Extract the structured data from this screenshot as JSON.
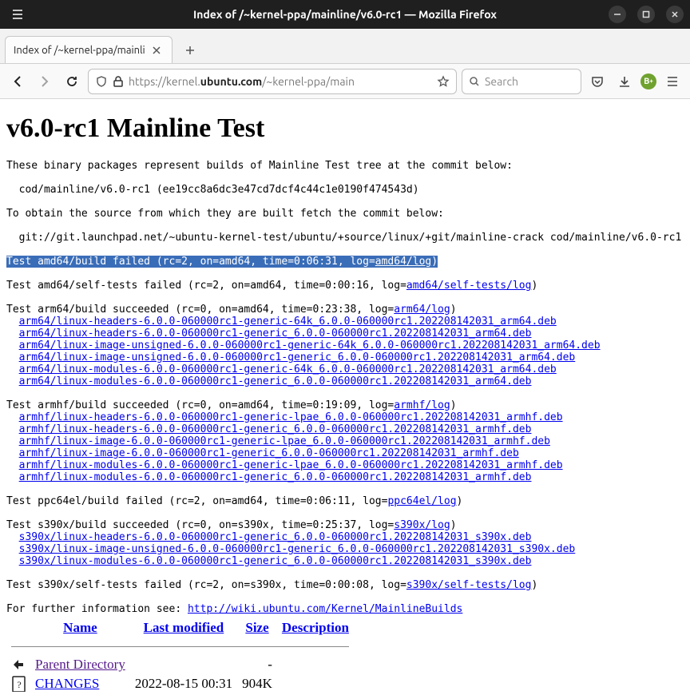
{
  "window": {
    "title": "Index of /~kernel-ppa/mainline/v6.0-rc1 — Mozilla Firefox"
  },
  "tab": {
    "label": "Index of /~kernel-ppa/mainli"
  },
  "urlbar": {
    "scheme": "https://",
    "pre": "kernel.",
    "host": "ubuntu.com",
    "path": "/~kernel-ppa/main"
  },
  "searchbar": {
    "placeholder": "Search"
  },
  "extension": {
    "letter": "B"
  },
  "page": {
    "h1": "v6.0-rc1 Mainline Test",
    "l1": "These binary packages represent builds of Mainline Test tree at the commit below:",
    "l2": "  cod/mainline/v6.0-rc1 (ee19cc8a6dc3e47cd7dcf4c44c1e0190f474543d)",
    "l3": "To obtain the source from which they are built fetch the commit below:",
    "l4": "  git://git.launchpad.net/~ubuntu-kernel-test/ubuntu/+source/linux/+git/mainline-crack cod/mainline/v6.0-rc1",
    "amd64_fail_pre": "Test amd64/build failed (rc=2, on=amd64, time=0:06:31, log=",
    "amd64_fail_log": "amd64/log",
    "amd64_fail_post": ")",
    "amd64_self_pre": "Test amd64/self-tests failed (rc=2, on=amd64, time=0:00:16, log=",
    "amd64_self_log": "amd64/self-tests/log",
    "amd64_self_post": ")",
    "arm64_pre": "Test arm64/build succeeded (rc=0, on=amd64, time=0:23:38, log=",
    "arm64_log": "arm64/log",
    "arm64_post": ")",
    "arm64_files": [
      "arm64/linux-headers-6.0.0-060000rc1-generic-64k_6.0.0-060000rc1.202208142031_arm64.deb",
      "arm64/linux-headers-6.0.0-060000rc1-generic_6.0.0-060000rc1.202208142031_arm64.deb",
      "arm64/linux-image-unsigned-6.0.0-060000rc1-generic-64k_6.0.0-060000rc1.202208142031_arm64.deb",
      "arm64/linux-image-unsigned-6.0.0-060000rc1-generic_6.0.0-060000rc1.202208142031_arm64.deb",
      "arm64/linux-modules-6.0.0-060000rc1-generic-64k_6.0.0-060000rc1.202208142031_arm64.deb",
      "arm64/linux-modules-6.0.0-060000rc1-generic_6.0.0-060000rc1.202208142031_arm64.deb"
    ],
    "armhf_pre": "Test armhf/build succeeded (rc=0, on=amd64, time=0:19:09, log=",
    "armhf_log": "armhf/log",
    "armhf_post": ")",
    "armhf_files": [
      "armhf/linux-headers-6.0.0-060000rc1-generic-lpae_6.0.0-060000rc1.202208142031_armhf.deb",
      "armhf/linux-headers-6.0.0-060000rc1-generic_6.0.0-060000rc1.202208142031_armhf.deb",
      "armhf/linux-image-6.0.0-060000rc1-generic-lpae_6.0.0-060000rc1.202208142031_armhf.deb",
      "armhf/linux-image-6.0.0-060000rc1-generic_6.0.0-060000rc1.202208142031_armhf.deb",
      "armhf/linux-modules-6.0.0-060000rc1-generic-lpae_6.0.0-060000rc1.202208142031_armhf.deb",
      "armhf/linux-modules-6.0.0-060000rc1-generic_6.0.0-060000rc1.202208142031_armhf.deb"
    ],
    "ppc_pre": "Test ppc64el/build failed (rc=2, on=amd64, time=0:06:11, log=",
    "ppc_log": "ppc64el/log",
    "ppc_post": ")",
    "s390_pre": "Test s390x/build succeeded (rc=0, on=s390x, time=0:25:37, log=",
    "s390_log": "s390x/log",
    "s390_post": ")",
    "s390_files": [
      "s390x/linux-headers-6.0.0-060000rc1-generic_6.0.0-060000rc1.202208142031_s390x.deb",
      "s390x/linux-image-unsigned-6.0.0-060000rc1-generic_6.0.0-060000rc1.202208142031_s390x.deb",
      "s390x/linux-modules-6.0.0-060000rc1-generic_6.0.0-060000rc1.202208142031_s390x.deb"
    ],
    "s390_self_pre": "Test s390x/self-tests failed (rc=2, on=s390x, time=0:00:08, log=",
    "s390_self_log": "s390x/self-tests/log",
    "s390_self_post": ")",
    "info_pre": "For further information see: ",
    "info_link": "http://wiki.ubuntu.com/Kernel/MainlineBuilds",
    "table": {
      "headers": [
        "Name",
        "Last modified",
        "Size",
        "Description"
      ],
      "rows": [
        {
          "icon": "back",
          "name": "Parent Directory",
          "visited": true,
          "date": "",
          "size": "-"
        },
        {
          "icon": "unknown",
          "name": "CHANGES",
          "visited": false,
          "date": "2022-08-15 00:31",
          "size": "904K"
        }
      ]
    }
  }
}
